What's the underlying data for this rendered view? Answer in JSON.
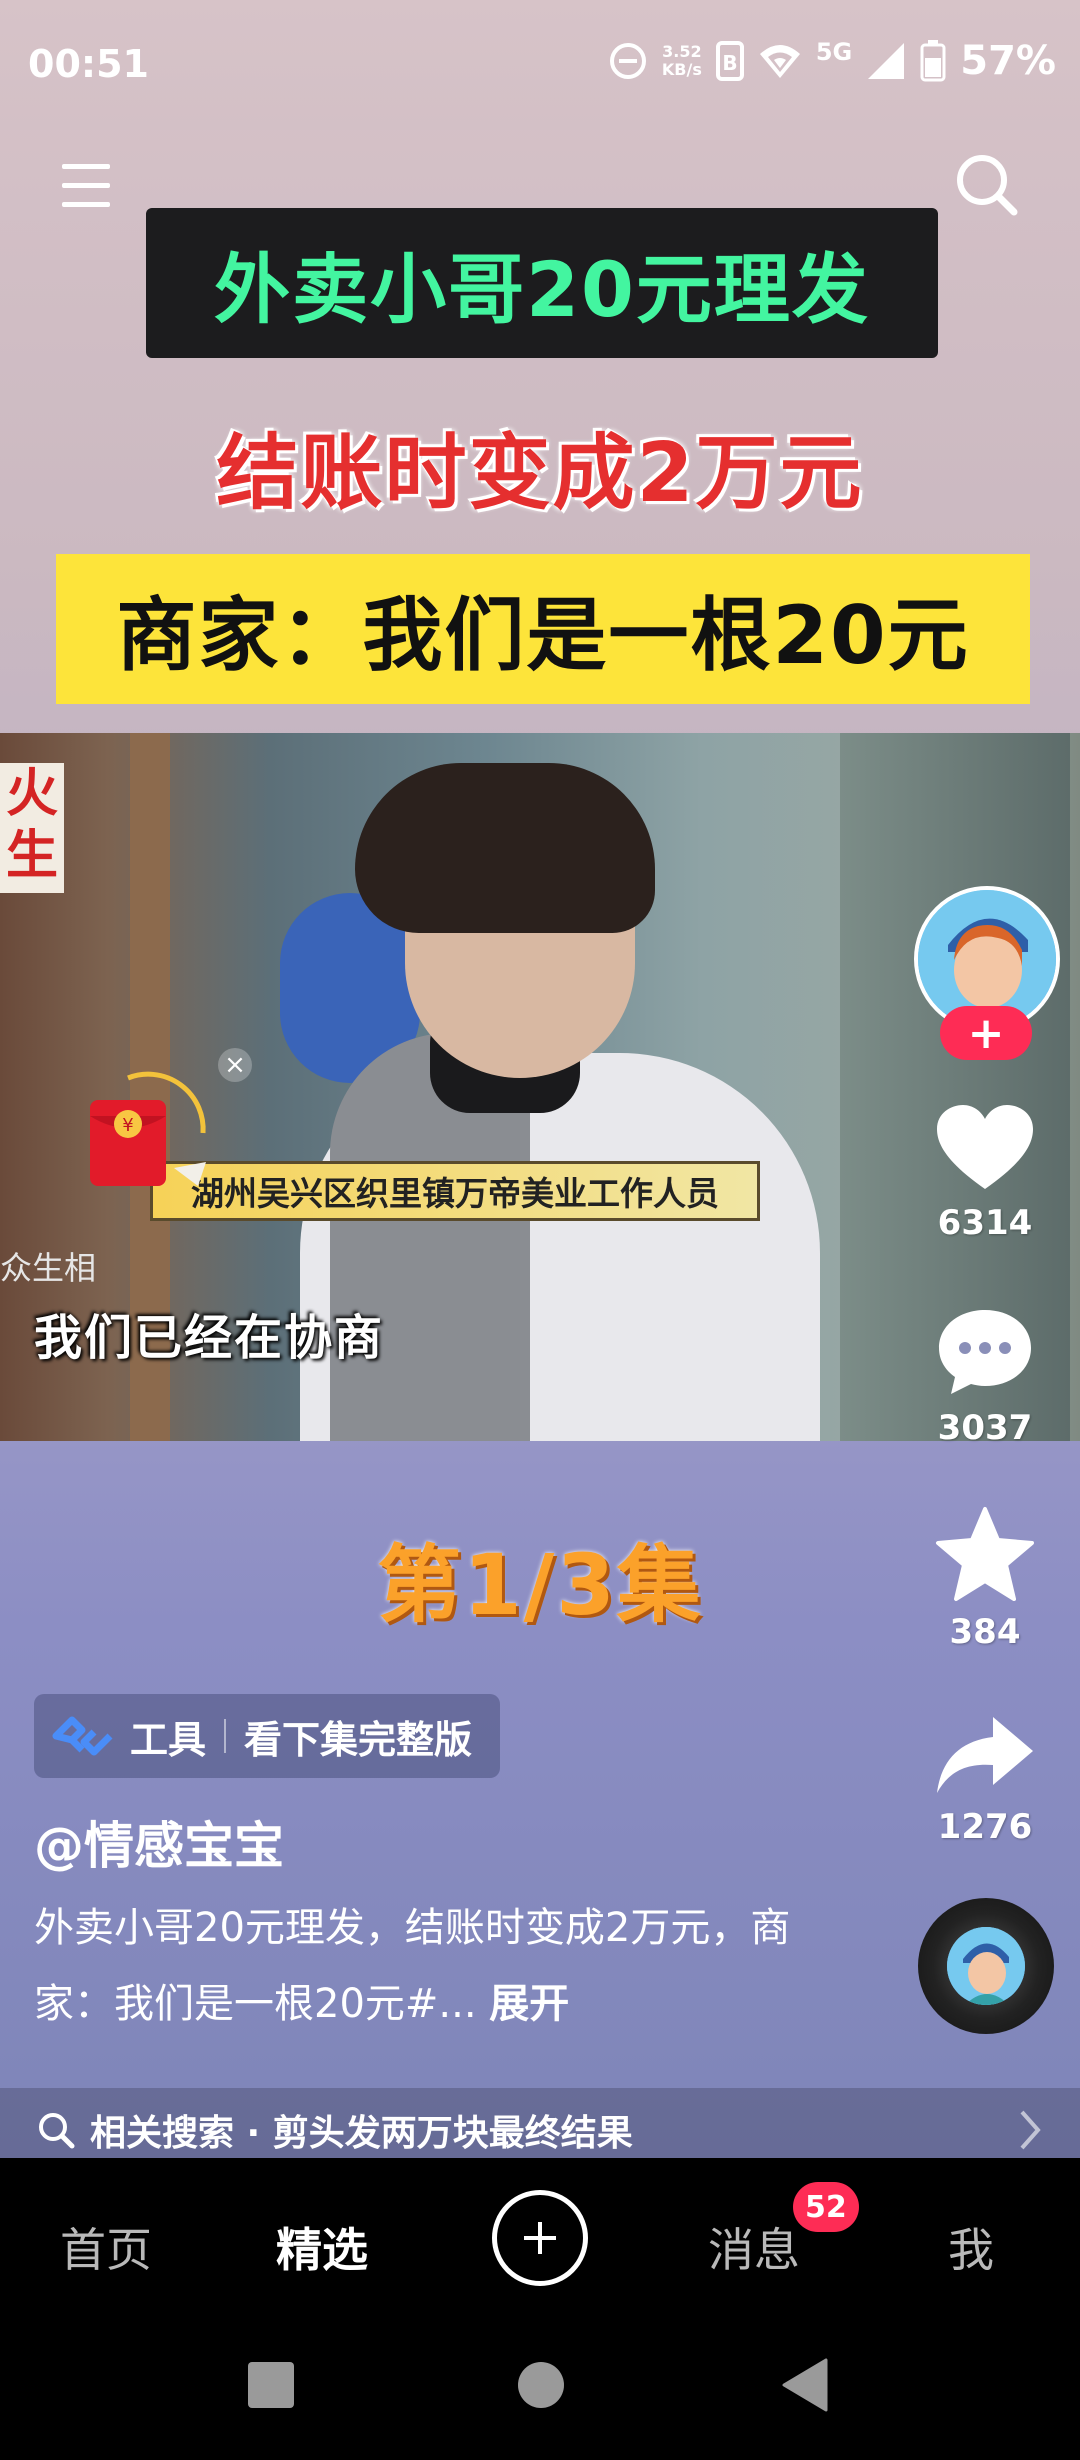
{
  "status_bar": {
    "time": "00:51",
    "net_speed_value": "3.52",
    "net_speed_unit": "KB/s",
    "network": "5G",
    "battery": "57%"
  },
  "icons": {
    "menu": "menu-icon",
    "search": "search-icon",
    "like": "heart-icon",
    "comment": "comment-icon",
    "favorite": "star-icon",
    "share": "share-icon"
  },
  "headline": {
    "line1": "外卖小哥20元理发",
    "line2": "结账时变成2万元",
    "line3": "商家：我们是一根20元"
  },
  "video": {
    "shop_sign": "火\n生",
    "caption_bar": "湖州吴兴区织里镇万帝美业工作人员",
    "watermark": "众生相",
    "subtitle": "我们已经在协商"
  },
  "episode_label": "第1/3集",
  "actions": {
    "likes": "6314",
    "comments": "3037",
    "favorites": "384",
    "shares": "1276"
  },
  "tool_chip": {
    "tool_label": "工具",
    "action_label": "看下集完整版"
  },
  "author": "@情感宝宝",
  "description": {
    "text": "外卖小哥20元理发，结账时变成2万元，商家：我们是一根20元#...",
    "more": "展开"
  },
  "related_search": {
    "label": "相关搜索 · 剪头发两万块最终结果"
  },
  "playback_progress": 0,
  "tabs": [
    {
      "label": "首页"
    },
    {
      "label": "精选"
    },
    {
      "label": "消息"
    },
    {
      "label": "我"
    }
  ],
  "message_badge": "52",
  "colors": {
    "accent": "#fe2c55",
    "headline_green": "#43f5a0",
    "headline_red": "#e52f2f",
    "headline_yellow_bg": "#fde43a",
    "episode_orange": "#fba12a"
  }
}
